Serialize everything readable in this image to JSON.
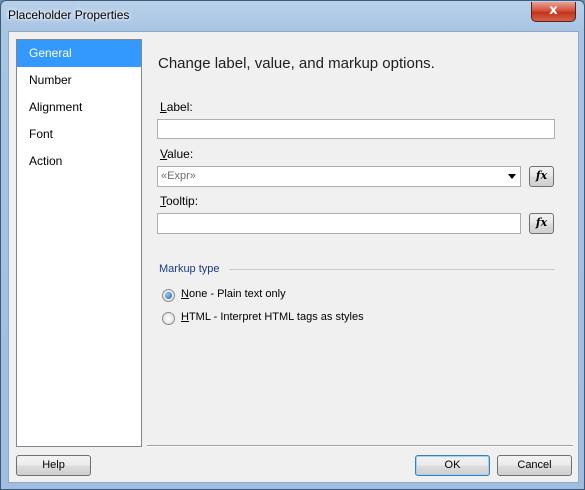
{
  "window": {
    "title": "Placeholder Properties",
    "close_glyph": "x"
  },
  "nav": {
    "items": [
      "General",
      "Number",
      "Alignment",
      "Font",
      "Action"
    ],
    "selected": "General"
  },
  "heading": "Change label, value, and markup options.",
  "fields": {
    "label": {
      "mnemonic": "L",
      "rest": "abel:",
      "value": ""
    },
    "value": {
      "mnemonic": "V",
      "rest": "alue:",
      "value": "«Expr»"
    },
    "tooltip": {
      "mnemonic": "T",
      "rest": "ooltip:",
      "value": ""
    }
  },
  "fx_button_label": "fx",
  "markup": {
    "group_label": "Markup type",
    "options": [
      {
        "mnemonic": "N",
        "rest": "one - Plain text only",
        "checked": true
      },
      {
        "mnemonic": "H",
        "rest": "TML - Interpret HTML tags as styles",
        "checked": false
      }
    ]
  },
  "buttons": {
    "help": "Help",
    "ok": "OK",
    "cancel": "Cancel"
  }
}
